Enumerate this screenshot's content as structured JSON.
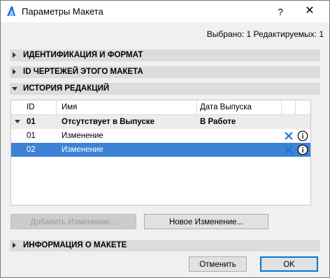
{
  "window": {
    "title": "Параметры Макета",
    "help_label": "?",
    "close_label": "✕"
  },
  "status": "Выбрано: 1 Редактируемых: 1",
  "sections": {
    "ident": "ИДЕНТИФИКАЦИЯ И ФОРМАТ",
    "drawings": "ID ЧЕРТЕЖЕЙ ЭТОГО МАКЕТА",
    "history": "ИСТОРИЯ РЕДАКЦИЙ",
    "info": "ИНФОРМАЦИЯ О МАКЕТЕ"
  },
  "table": {
    "headers": {
      "id": "ID",
      "name": "Имя",
      "date": "Дата Выпуска"
    },
    "group": {
      "id": "01",
      "name": "Отсутствует в Выпуске",
      "date": "В Работе"
    },
    "rows": [
      {
        "id": "01",
        "name": "Изменение",
        "selected": false
      },
      {
        "id": "02",
        "name": "Изменение",
        "selected": true
      }
    ]
  },
  "buttons": {
    "add_change": "Добавить Изменение...",
    "new_change": "Новое Изменение...",
    "cancel": "Отменить",
    "ok": "OK"
  },
  "colors": {
    "selection": "#3c83d6",
    "delete_icon": "#1e73d2"
  },
  "icons": {
    "app": "archicad-logo-icon",
    "delete": "delete-x-icon",
    "info": "info-circle-icon"
  }
}
